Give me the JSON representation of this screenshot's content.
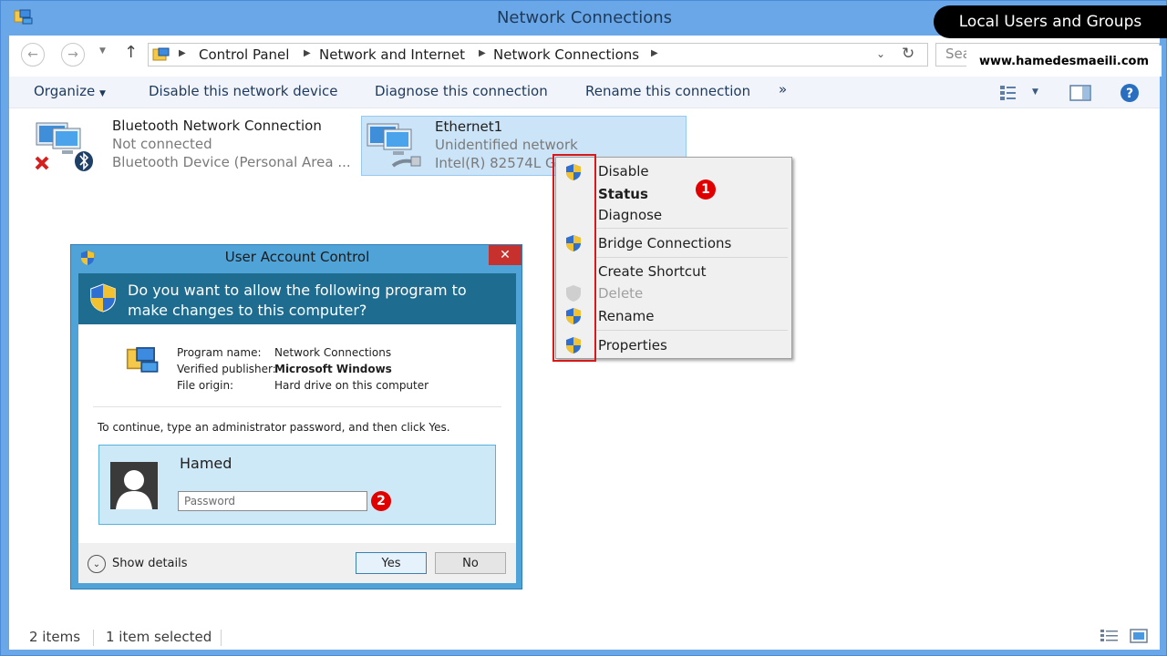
{
  "window": {
    "title": "Network Connections"
  },
  "address": {
    "crumbs": [
      "Control Panel",
      "Network and Internet",
      "Network Connections"
    ],
    "search_placeholder": "Sea"
  },
  "commands": [
    "Organize",
    "Disable this network device",
    "Diagnose this connection",
    "Rename this connection",
    "»"
  ],
  "items": [
    {
      "name": "Bluetooth Network Connection",
      "status": "Not connected",
      "device": "Bluetooth Device (Personal Area ..."
    },
    {
      "name": "Ethernet1",
      "status": "Unidentified network",
      "device": "Intel(R) 82574L G"
    }
  ],
  "context_menu": {
    "items": [
      "Disable",
      "Status",
      "Diagnose",
      "Bridge Connections",
      "Create Shortcut",
      "Delete",
      "Rename",
      "Properties"
    ],
    "badge": "1"
  },
  "uac": {
    "title": "User Account Control",
    "close": "✕",
    "question": "Do you want to allow the following program to make changes to this computer?",
    "program_label": "Program name:",
    "program_value": "Network Connections",
    "publisher_label": "Verified publisher:",
    "publisher_value": "Microsoft Windows",
    "origin_label": "File origin:",
    "origin_value": "Hard drive on this computer",
    "instruction": "To continue, type an administrator password, and then click Yes.",
    "user": "Hamed",
    "password_placeholder": "Password",
    "badge": "2",
    "show_details": "Show details",
    "yes": "Yes",
    "no": "No"
  },
  "status": {
    "count": "2 items",
    "selected": "1 item selected"
  },
  "watermark": {
    "title": "Local Users and Groups",
    "url": "www.hamedesmaeili.com"
  }
}
